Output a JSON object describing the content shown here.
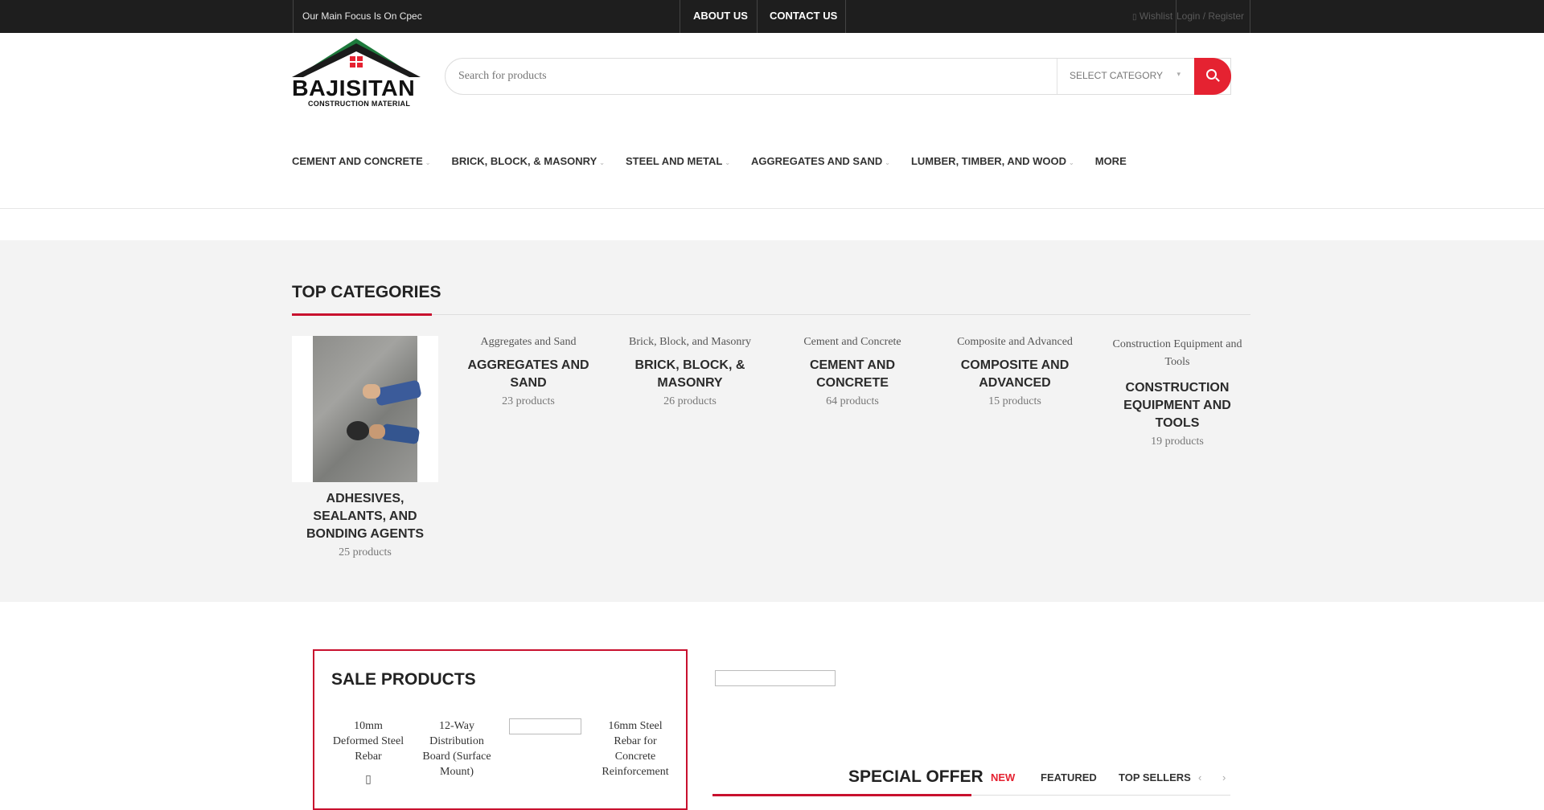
{
  "topbar": {
    "tagline": "Our Main Focus Is On Cpec",
    "about": "ABOUT US",
    "contact": "CONTACT US",
    "wishlist": "Wishlist",
    "login": "Login / Register"
  },
  "logo": {
    "name": "BAJISITAN",
    "subtitle": "CONSTRUCTION MATERIAL"
  },
  "search": {
    "placeholder": "Search for products",
    "category": "SELECT CATEGORY"
  },
  "nav": {
    "items": [
      {
        "label": "CEMENT AND CONCRETE",
        "has_sub": true
      },
      {
        "label": "BRICK, BLOCK, & MASONRY",
        "has_sub": true
      },
      {
        "label": "STEEL AND METAL",
        "has_sub": true
      },
      {
        "label": "AGGREGATES AND SAND",
        "has_sub": true
      },
      {
        "label": "LUMBER, TIMBER, AND WOOD",
        "has_sub": true
      },
      {
        "label": "MORE",
        "has_sub": false
      }
    ]
  },
  "top_categories": {
    "heading": "TOP CATEGORIES",
    "items": [
      {
        "alt": "",
        "name": "ADHESIVES, SEALANTS, AND BONDING AGENTS",
        "count": "25 products"
      },
      {
        "alt": "Aggregates and Sand",
        "name": "AGGREGATES AND SAND",
        "count": "23 products"
      },
      {
        "alt": "Brick, Block, and Masonry",
        "name": "BRICK, BLOCK, & MASONRY",
        "count": "26 products"
      },
      {
        "alt": "Cement and Concrete",
        "name": "CEMENT AND CONCRETE",
        "count": "64 products"
      },
      {
        "alt": "Composite and Advanced",
        "name": "COMPOSITE AND ADVANCED",
        "count": "15 products"
      },
      {
        "alt": "Construction Equipment and Tools",
        "name": "CONSTRUCTION EQUIPMENT AND TOOLS",
        "count": "19 products"
      }
    ]
  },
  "sale": {
    "title": "SALE PRODUCTS",
    "items": [
      {
        "alt": "10mm Deformed Steel Rebar"
      },
      {
        "alt": "12-Way Distribution Board (Surface Mount)"
      },
      {
        "alt": ""
      },
      {
        "alt": "16mm Steel Rebar for Concrete Reinforcement"
      }
    ]
  },
  "products_tabs": {
    "title": "SPECIAL OFFER",
    "tabs": [
      "NEW",
      "FEATURED",
      "TOP SELLERS"
    ],
    "active": "NEW"
  },
  "colors": {
    "accent": "#e52231",
    "topbar_bg": "#1e1e1e",
    "section_bg": "#f3f3f3",
    "logo_green": "#1e7a3c"
  }
}
